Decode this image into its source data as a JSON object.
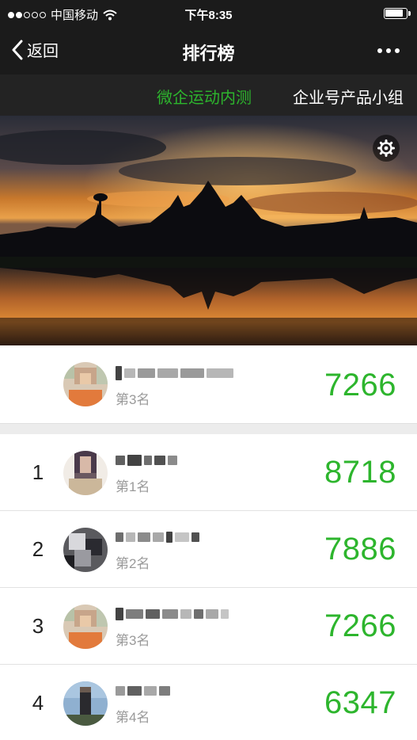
{
  "status_bar": {
    "carrier": "中国移动",
    "time": "下午8:35"
  },
  "nav": {
    "back_label": "返回",
    "title": "排行榜"
  },
  "tabs": [
    {
      "label": "微企运动内测",
      "active": true
    },
    {
      "label": "企业号产品小组",
      "active": false
    }
  ],
  "colors": {
    "accent": "#2db52d",
    "bar": "#1b1b1b"
  },
  "my_entry": {
    "rank_caption": "第3名",
    "steps": "7266"
  },
  "rankings": [
    {
      "rank": "1",
      "rank_caption": "第1名",
      "steps": "8718"
    },
    {
      "rank": "2",
      "rank_caption": "第2名",
      "steps": "7886"
    },
    {
      "rank": "3",
      "rank_caption": "第3名",
      "steps": "7266"
    },
    {
      "rank": "4",
      "rank_caption": "第4名",
      "steps": "6347"
    }
  ],
  "icons": {
    "back": "chevron-left-icon",
    "more": "more-dots-icon",
    "settings": "gear-icon",
    "wifi": "wifi-icon",
    "battery": "battery-icon"
  }
}
